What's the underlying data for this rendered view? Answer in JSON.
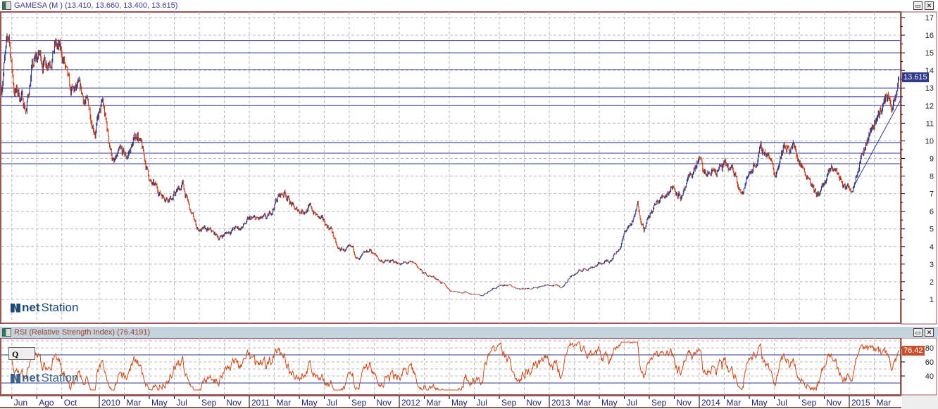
{
  "header": {
    "title": "GAMESA (M ) (13.410, 13.660, 13.400, 13.615)",
    "last": "13.615"
  },
  "rsi_header": {
    "title": "RSI (Relative Strength Index) (76.4191)",
    "last": "76.42"
  },
  "q_label": "Q",
  "logo": {
    "brand_a": "net",
    "brand_b": "Station"
  },
  "colors": {
    "up": "#2f3a8e",
    "down": "#cc3d12",
    "level": "#2f3a8e",
    "rsi": "#cc4a1a",
    "border": "#9a5555"
  },
  "chart_data": [
    {
      "type": "ohlc",
      "title": "GAMESA (M )",
      "ylim": [
        0,
        17
      ],
      "yticks": [
        1,
        2,
        3,
        4,
        5,
        6,
        7,
        8,
        9,
        10,
        11,
        12,
        13,
        14,
        15,
        16,
        17
      ],
      "xaxis_unit": "months since May 2009",
      "x_labels": [
        {
          "t": 1,
          "l": "Jun"
        },
        {
          "t": 3,
          "l": "Ago"
        },
        {
          "t": 5,
          "l": "Oct"
        },
        {
          "t": 8,
          "l": "2010"
        },
        {
          "t": 10,
          "l": "Mar"
        },
        {
          "t": 12,
          "l": "May"
        },
        {
          "t": 14,
          "l": "Jul"
        },
        {
          "t": 16,
          "l": "Sep"
        },
        {
          "t": 18,
          "l": "Nov"
        },
        {
          "t": 20,
          "l": "2011"
        },
        {
          "t": 22,
          "l": "Mar"
        },
        {
          "t": 24,
          "l": "May"
        },
        {
          "t": 26,
          "l": "Jul"
        },
        {
          "t": 28,
          "l": "Sep"
        },
        {
          "t": 30,
          "l": "Nov"
        },
        {
          "t": 32,
          "l": "2012"
        },
        {
          "t": 34,
          "l": "Mar"
        },
        {
          "t": 36,
          "l": "May"
        },
        {
          "t": 38,
          "l": "Jul"
        },
        {
          "t": 40,
          "l": "Sep"
        },
        {
          "t": 42,
          "l": "Nov"
        },
        {
          "t": 44,
          "l": "2013"
        },
        {
          "t": 46,
          "l": "Mar"
        },
        {
          "t": 48,
          "l": "May"
        },
        {
          "t": 50,
          "l": "Jul"
        },
        {
          "t": 52,
          "l": "Sep"
        },
        {
          "t": 54,
          "l": "Nov"
        },
        {
          "t": 56,
          "l": "2014"
        },
        {
          "t": 58,
          "l": "Mar"
        },
        {
          "t": 60,
          "l": "May"
        },
        {
          "t": 62,
          "l": "Jul"
        },
        {
          "t": 64,
          "l": "Sep"
        },
        {
          "t": 66,
          "l": "Nov"
        },
        {
          "t": 68,
          "l": "2015"
        },
        {
          "t": 70,
          "l": "Mar"
        }
      ],
      "levels": [
        15.7,
        15.0,
        14.05,
        13.0,
        12.5,
        12.0,
        9.9,
        9.3,
        8.7
      ],
      "trendline": [
        [
          68.1,
          7.3
        ],
        [
          72,
          12.4
        ]
      ],
      "last_close": 13.615,
      "price_path": [
        [
          0,
          13
        ],
        [
          0.2,
          14.5
        ],
        [
          0.6,
          15.8
        ],
        [
          1,
          13
        ],
        [
          1.6,
          12.5
        ],
        [
          2,
          11.8
        ],
        [
          2.4,
          14
        ],
        [
          3,
          14.8
        ],
        [
          3.5,
          14.5
        ],
        [
          4.3,
          15.5
        ],
        [
          5,
          14.5
        ],
        [
          5.5,
          12.5
        ],
        [
          6.1,
          12.8
        ],
        [
          6.9,
          12
        ],
        [
          7.5,
          10.8
        ],
        [
          8.1,
          12
        ],
        [
          8.6,
          10
        ],
        [
          9,
          8.7
        ],
        [
          9.5,
          9.2
        ],
        [
          10,
          9
        ],
        [
          10.9,
          10.5
        ],
        [
          11.4,
          9
        ],
        [
          12,
          7.5
        ],
        [
          12.8,
          7
        ],
        [
          13.7,
          6.8
        ],
        [
          14.5,
          7.5
        ],
        [
          15.1,
          6
        ],
        [
          15.7,
          5
        ],
        [
          16.8,
          4.8
        ],
        [
          17.4,
          4.5
        ],
        [
          18.5,
          5
        ],
        [
          19,
          5
        ],
        [
          19.9,
          5.5
        ],
        [
          21.3,
          5.5
        ],
        [
          22.1,
          6.8
        ],
        [
          22.7,
          7.1
        ],
        [
          23.5,
          6
        ],
        [
          24.7,
          6.2
        ],
        [
          25.5,
          5.5
        ],
        [
          26.4,
          5
        ],
        [
          26.9,
          3.8
        ],
        [
          28.1,
          3.8
        ],
        [
          28.6,
          3.2
        ],
        [
          29.5,
          3.8
        ],
        [
          30.3,
          3.2
        ],
        [
          31.4,
          3.1
        ],
        [
          33.1,
          3
        ],
        [
          33.7,
          2.5
        ],
        [
          34.8,
          2.2
        ],
        [
          35.9,
          1.5
        ],
        [
          37.1,
          1.4
        ],
        [
          38.5,
          1.2
        ],
        [
          39.3,
          1.6
        ],
        [
          40.5,
          1.8
        ],
        [
          41.6,
          1.6
        ],
        [
          42.7,
          1.7
        ],
        [
          43.8,
          1.8
        ],
        [
          44.9,
          1.7
        ],
        [
          45.5,
          2.3
        ],
        [
          46.6,
          2.7
        ],
        [
          47.8,
          3
        ],
        [
          48.6,
          3.2
        ],
        [
          49.5,
          4
        ],
        [
          50,
          5
        ],
        [
          50.6,
          5.5
        ],
        [
          50.9,
          6.3
        ],
        [
          51.4,
          5.1
        ],
        [
          52.3,
          6.3
        ],
        [
          53.1,
          7
        ],
        [
          53.7,
          7.5
        ],
        [
          54.5,
          6.8
        ],
        [
          55.1,
          7.8
        ],
        [
          55.8,
          9
        ],
        [
          56.2,
          8
        ],
        [
          57.1,
          8.3
        ],
        [
          57.9,
          8.5
        ],
        [
          58.8,
          8
        ],
        [
          59.3,
          7
        ],
        [
          59.9,
          8.3
        ],
        [
          60.7,
          9.3
        ],
        [
          61.3,
          9.4
        ],
        [
          61.9,
          8
        ],
        [
          62.4,
          9.6
        ],
        [
          63.3,
          9.8
        ],
        [
          64.1,
          8.5
        ],
        [
          64.7,
          8
        ],
        [
          65.2,
          6.8
        ],
        [
          65.8,
          7.5
        ],
        [
          66.6,
          8.5
        ],
        [
          67.5,
          7.3
        ],
        [
          68.1,
          7.4
        ],
        [
          68.6,
          9
        ],
        [
          69.5,
          10.5
        ],
        [
          70.3,
          11.8
        ],
        [
          70.9,
          12.5
        ],
        [
          71.4,
          12
        ],
        [
          71.6,
          12.3
        ],
        [
          71.8,
          13.615
        ]
      ]
    },
    {
      "type": "line",
      "title": "RSI (Relative Strength Index)",
      "period": 14,
      "last": 76.4191,
      "ylim": [
        20,
        90
      ],
      "yticks": [
        40,
        60,
        80
      ],
      "levels": [
        70,
        30
      ]
    }
  ]
}
